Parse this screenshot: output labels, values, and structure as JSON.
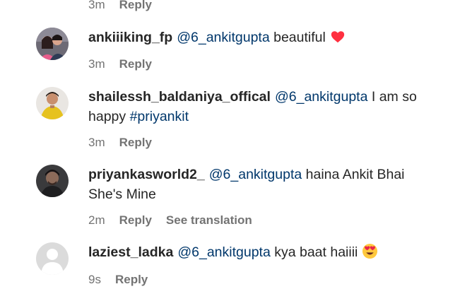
{
  "top": {
    "time": "3m",
    "reply": "Reply"
  },
  "comments": [
    {
      "username": "ankiiiking_fp",
      "mention": "@6_ankitgupta",
      "text_before_tag": " beautiful",
      "hashtag": "",
      "text_after_tag": "",
      "emoji": "red-heart",
      "time": "3m",
      "reply": "Reply"
    },
    {
      "username": "shailessh_baldaniya_offical",
      "mention": "@6_ankitgupta",
      "text_before_tag": " I am so happy ",
      "hashtag": "#priyankit",
      "time": "3m",
      "reply": "Reply"
    },
    {
      "username": "priyankasworld2_",
      "mention": "@6_ankitgupta",
      "text_before_tag": " haina Ankit Bhai She's Mine",
      "time": "2m",
      "reply": "Reply",
      "translate": "See translation"
    },
    {
      "username": "laziest_ladka",
      "mention": "@6_ankitgupta",
      "text_before_tag": " kya baat haiiii",
      "emoji": "heart-eyes",
      "time": "9s",
      "reply": "Reply"
    }
  ],
  "colors": {
    "meta_text": "#737373",
    "mention": "#00376b",
    "heart": "#ff3040",
    "emoji_face": "#ffc83d"
  }
}
